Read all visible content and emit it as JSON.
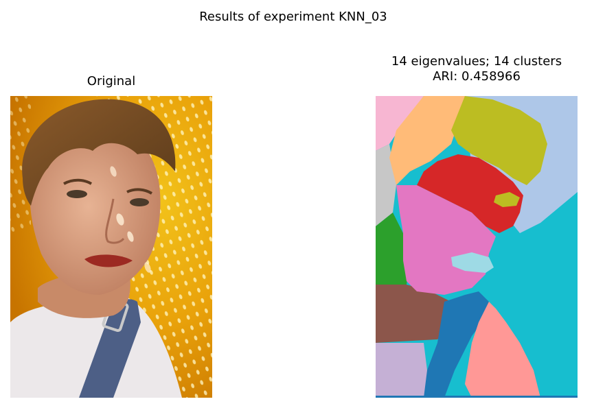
{
  "figure": {
    "suptitle": "Results of experiment KNN_03"
  },
  "left_panel": {
    "title": "Original",
    "image": "portrait photograph of a young woman with short brown hair in front of a yellow perforated metal wall, wearing a white top and denim overall strap"
  },
  "right_panel": {
    "title_line1": "14 eigenvalues; 14 clusters",
    "title_line2": "ARI: 0.458966",
    "image": "spectral clustering segmentation map with 14 colored clusters",
    "cluster_colors": [
      "#1f77b4",
      "#aec7e8",
      "#ffbb78",
      "#2ca02c",
      "#d62728",
      "#9467bd",
      "#8c564b",
      "#c49c94",
      "#e377c2",
      "#f7b6d2",
      "#c7c7c7",
      "#bcbd22",
      "#17becf",
      "#9edae5",
      "#ff9896",
      "#c5b0d5"
    ]
  }
}
